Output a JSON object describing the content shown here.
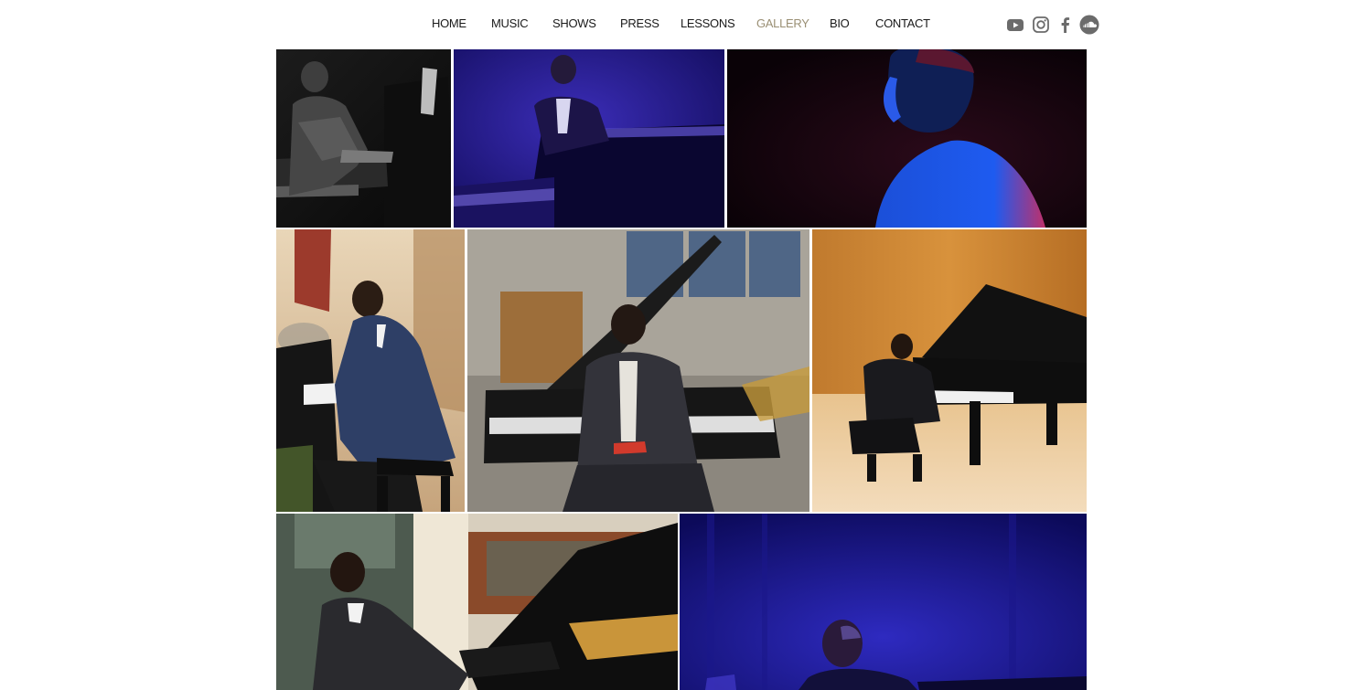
{
  "nav": {
    "items": [
      {
        "label": "HOME"
      },
      {
        "label": "MUSIC"
      },
      {
        "label": "SHOWS"
      },
      {
        "label": "PRESS"
      },
      {
        "label": "LESSONS"
      },
      {
        "label": "GALLERY",
        "active": true
      },
      {
        "label": "BIO"
      },
      {
        "label": "CONTACT"
      }
    ],
    "active_color": "#9a8f74",
    "text_color": "#1a1a1a"
  },
  "social": {
    "icons": [
      "youtube-icon",
      "instagram-icon",
      "facebook-icon",
      "soundcloud-icon"
    ],
    "color": "#6b6b6b"
  },
  "gallery": {
    "photos": [
      {
        "name": "bw-pianist-profile",
        "tone": "black-and-white"
      },
      {
        "name": "blue-stage-pianist",
        "tone": "blue"
      },
      {
        "name": "back-view-blue-light",
        "tone": "dark-red-blue"
      },
      {
        "name": "banquet-pianist",
        "tone": "warm"
      },
      {
        "name": "seated-before-piano",
        "tone": "muted"
      },
      {
        "name": "recital-hall-piano",
        "tone": "wood"
      },
      {
        "name": "parlor-grand-piano",
        "tone": "warm-gold"
      },
      {
        "name": "blue-stage-closeup",
        "tone": "blue"
      }
    ]
  }
}
